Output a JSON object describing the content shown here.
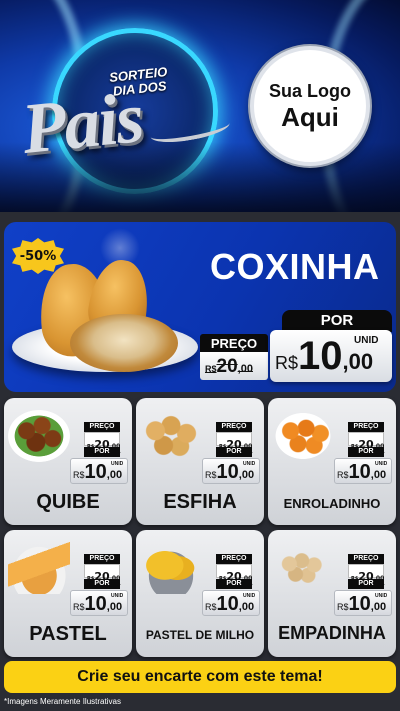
{
  "header": {
    "campaign_line1": "SORTEIO",
    "campaign_line2": "DIA DOS",
    "campaign_word": "Pais",
    "logo_line1": "Sua Logo",
    "logo_line2": "Aqui"
  },
  "featured": {
    "discount_badge": "-50%",
    "name": "COXINHA",
    "old_label": "PREÇO",
    "old_currency": "R$",
    "old_int": "20",
    "old_dec": ",00",
    "new_label": "POR",
    "new_currency": "R$",
    "new_int": "10",
    "new_dec": ",00",
    "unit": "UNID"
  },
  "products": [
    {
      "name": "QUIBE",
      "old_label": "PREÇO",
      "old_currency": "R$",
      "old_int": "20",
      "old_dec": ",00",
      "new_label": "POR",
      "new_currency": "R$",
      "new_int": "10",
      "new_dec": ",00",
      "unit": "UNID"
    },
    {
      "name": "ESFIHA",
      "old_label": "PREÇO",
      "old_currency": "R$",
      "old_int": "20",
      "old_dec": ",00",
      "new_label": "POR",
      "new_currency": "R$",
      "new_int": "10",
      "new_dec": ",00",
      "unit": "UNID"
    },
    {
      "name": "ENROLADINHO",
      "old_label": "PREÇO",
      "old_currency": "R$",
      "old_int": "20",
      "old_dec": ",00",
      "new_label": "POR",
      "new_currency": "R$",
      "new_int": "10",
      "new_dec": ",00",
      "unit": "UNID"
    },
    {
      "name": "PASTEL",
      "old_label": "PREÇO",
      "old_currency": "R$",
      "old_int": "20",
      "old_dec": ",00",
      "new_label": "POR",
      "new_currency": "R$",
      "new_int": "10",
      "new_dec": ",00",
      "unit": "UNID"
    },
    {
      "name": "PASTEL DE MILHO",
      "old_label": "PREÇO",
      "old_currency": "R$",
      "old_int": "20",
      "old_dec": ",00",
      "new_label": "POR",
      "new_currency": "R$",
      "new_int": "10",
      "new_dec": ",00",
      "unit": "UNID"
    },
    {
      "name": "EMPADINHA",
      "old_label": "PREÇO",
      "old_currency": "R$",
      "old_int": "20",
      "old_dec": ",00",
      "new_label": "POR",
      "new_currency": "R$",
      "new_int": "10",
      "new_dec": ",00",
      "unit": "UNID"
    }
  ],
  "footer": {
    "cta": "Crie seu encarte com este tema!",
    "disclaimer": "*Imagens Meramente Ilustrativas"
  },
  "colors": {
    "accent_yellow": "#fbd114",
    "feature_blue": "#0b34b0",
    "neon_cyan": "#39d8ff",
    "card_grey": "#e3e5e8",
    "tag_black": "#0b0b0b"
  }
}
